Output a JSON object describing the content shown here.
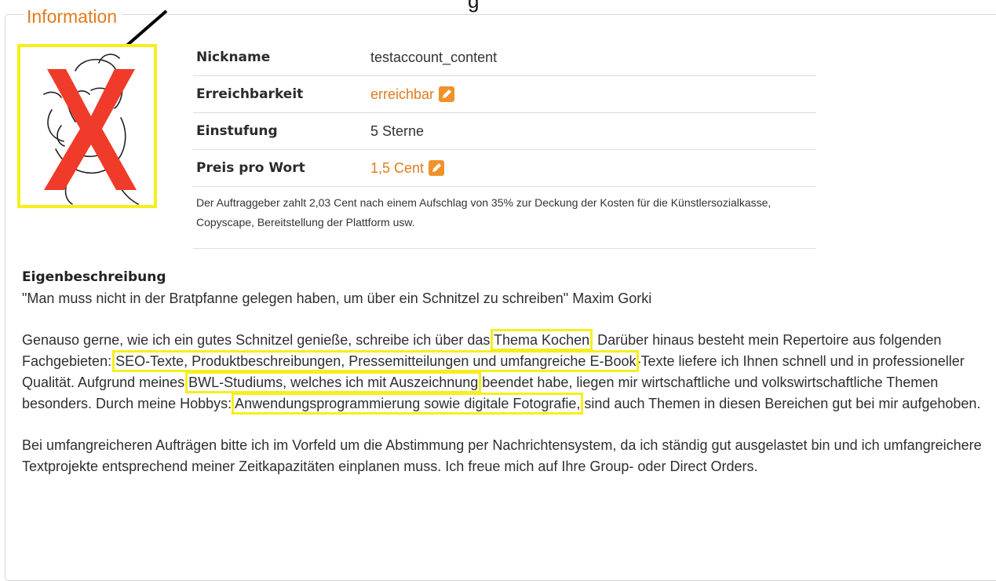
{
  "top_fragment": "g",
  "section": {
    "legend": "Information"
  },
  "profile": {
    "rows": [
      {
        "label": "Nickname",
        "value": "testaccount_content",
        "editable": false
      },
      {
        "label": "Erreichbarkeit",
        "value": "erreichbar",
        "editable": true
      },
      {
        "label": "Einstufung",
        "value": "5 Sterne",
        "editable": false
      },
      {
        "label": "Preis pro Wort",
        "value": "1,5 Cent",
        "editable": true
      }
    ],
    "note": "Der Auftraggeber zahlt 2,03 Cent nach einem Aufschlag von 35% zur Deckung der Kosten für die Künstlersozialkasse, Copyscape, Bereitstellung der Plattform usw."
  },
  "description": {
    "heading": "Eigenbeschreibung",
    "quote": "\"Man muss nicht in der Bratpfanne gelegen haben, um über ein Schnitzel zu schreiben\" Maxim Gorki",
    "p2": {
      "t1": "Genauso gerne, wie ich ein gutes Schnitzel genieße, schreibe ich über das ",
      "h1": "Thema Kochen",
      "t2": ". Darüber hinaus besteht mein Repertoire aus folgenden Fachgebieten: ",
      "h2": "SEO-Texte, Produktbeschreibungen, Pressemitteilungen und umfangreiche E-Book",
      "t3": "-Texte liefere ich Ihnen schnell und in professioneller Qualität. Aufgrund meines ",
      "h3": "BWL-Studiums, welches ich mit Auszeichnung",
      "t4": " beendet habe, liegen mir wirtschaftliche und volkswirtschaftliche Themen besonders. Durch meine Hobbys: ",
      "h4": "Anwendungsprogrammierung sowie digitale Fotografie,",
      "t5": " sind auch Themen in diesen Bereichen gut bei mir aufgehoben."
    },
    "p3": "Bei umfangreicheren Aufträgen bitte ich im Vorfeld um die Abstimmung per Nachrichtensystem, da ich ständig gut ausgelastet bin und ich umfangreichere Textprojekte entsprechend meiner Zeitkapazitäten einplanen muss. Ich freue mich auf Ihre Group- oder Direct Orders."
  },
  "colors": {
    "accent": "#e07b1f",
    "highlight": "#f5ef1c",
    "cross": "#f03a2a"
  },
  "icons": [
    "edit-icon",
    "arrow-annotation",
    "cross-mark"
  ]
}
